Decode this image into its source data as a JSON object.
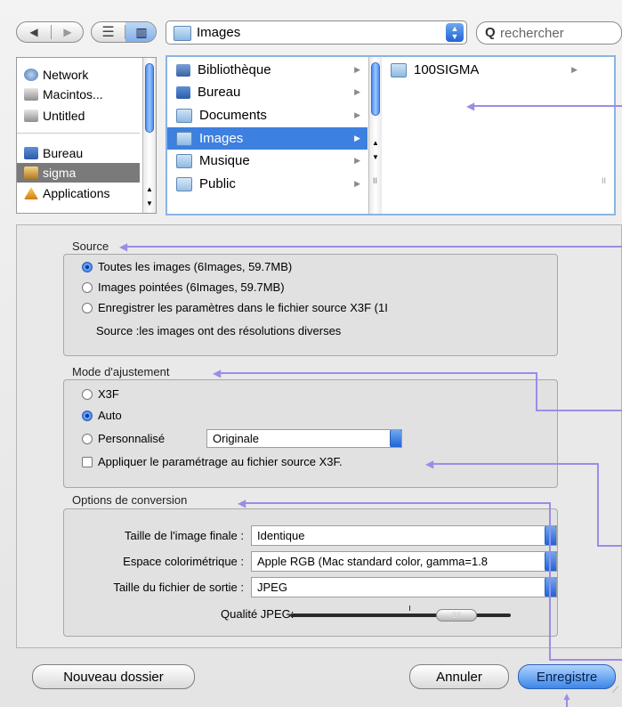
{
  "toolbar": {
    "view_list_icon": "list-view-icon",
    "view_column_icon": "column-view-icon",
    "location": "Images",
    "search_placeholder": "rechercher"
  },
  "sidebar": {
    "items": [
      {
        "label": "Network",
        "icon": "network-icon"
      },
      {
        "label": "Macintos...",
        "icon": "hard-disk-icon"
      },
      {
        "label": "Untitled",
        "icon": "hard-disk-icon"
      },
      {
        "label": "Bureau",
        "icon": "desktop-folder-icon"
      },
      {
        "label": "sigma",
        "icon": "home-icon"
      },
      {
        "label": "Applications",
        "icon": "applications-icon"
      }
    ]
  },
  "browser": {
    "column1": [
      {
        "label": "Bibliothèque"
      },
      {
        "label": "Bureau"
      },
      {
        "label": "Documents"
      },
      {
        "label": "Images"
      },
      {
        "label": "Musique"
      },
      {
        "label": "Public"
      }
    ],
    "column2": [
      {
        "label": "100SIGMA"
      }
    ]
  },
  "source": {
    "title": "Source",
    "opt1": "Toutes les images (6Images, 59.7MB)",
    "opt2": "Images pointées (6Images, 59.7MB)",
    "opt3": "Enregistrer les paramètres dans le fichier source  X3F (1I",
    "note": "Source :les images ont des résolutions diverses"
  },
  "adjust": {
    "title": "Mode d'ajustement",
    "opt1": "X3F",
    "opt2": "Auto",
    "opt3": "Personnalisé",
    "custom_value": "Originale",
    "checkbox": "Appliquer le paramétrage au fichier source X3F."
  },
  "conversion": {
    "title": "Options de conversion",
    "size_label": "Taille de l'image finale :",
    "size_value": "Identique",
    "color_label": "Espace colorimétrique :",
    "color_value": "Apple RGB (Mac standard color, gamma=1.8",
    "output_label": "Taille du fichier de sortie :",
    "output_value": "JPEG",
    "quality_label": "Qualité JPEG:",
    "quality_value": "10"
  },
  "buttons": {
    "new_folder": "Nouveau dossier",
    "cancel": "Annuler",
    "save": "Enregistre"
  },
  "colors": {
    "accent": "#3d80df",
    "annotation": "#9c8ce8"
  }
}
